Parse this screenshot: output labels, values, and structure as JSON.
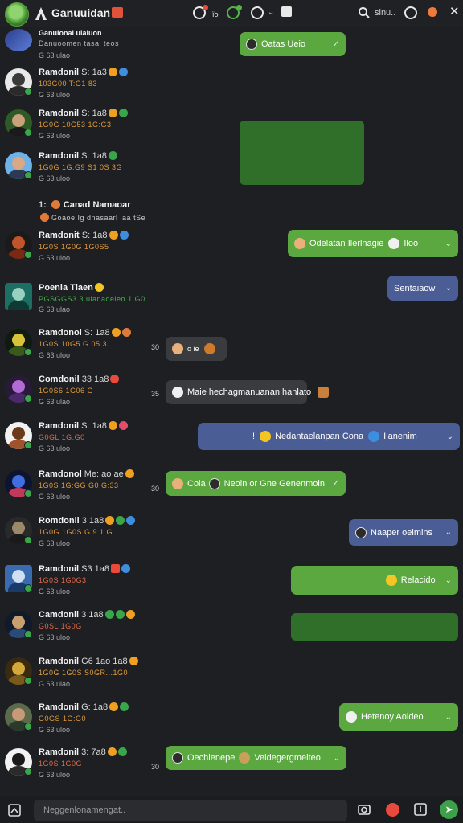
{
  "topbar": {
    "title": "Ganuuidan",
    "search_text": "sinu..",
    "colors": {
      "accent_green": "#5aa83f",
      "red": "#e84a3b"
    }
  },
  "rows": [
    {
      "name": "Ganulonal ulaluon",
      "time": "",
      "sub": "Danuoomen tasal teos",
      "meta": "G 63  ulao",
      "side": ""
    },
    {
      "name": "Ramdonil",
      "time": "S: 1a3",
      "sub": "103G00  T:G1 83",
      "meta": "G 63  uloo",
      "side": ""
    },
    {
      "name": "Ramdonil",
      "time": "S: 1a8",
      "sub": "1G0G  10G53  1G:G3",
      "meta": "G 63  uloo",
      "side": ""
    },
    {
      "name": "Ramdonil",
      "time": "S: 1a8",
      "sub": "1G0G  1G:G9  S1 0S 3G",
      "meta": "G 63  uloo",
      "side": ""
    },
    {
      "name": "Canad Namaoar",
      "time": "",
      "sub": "Goaoe  Ig dnasaarl laa tSe",
      "meta": "",
      "side": ""
    },
    {
      "name": "Ramdonit",
      "time": "S: 1a8",
      "sub": "1G0S  1G0G  1G0S5",
      "meta": "G 63  uloo",
      "side": ""
    },
    {
      "name": "Poenia  Tlaen",
      "time": "",
      "sub": "PGSGGS3  3  ulanaoeleo  1 G0",
      "meta": "G 63  ulao",
      "side": ""
    },
    {
      "name": "Ramdonol",
      "time": "S: 1a8",
      "sub": "1G0S  10G5  G 05 3",
      "meta": "G 63  uloo",
      "side": "30"
    },
    {
      "name": "Comdonil",
      "time": "33 1a8",
      "sub": "1G0S6  1G06  G",
      "meta": "G 63  ulao",
      "side": "35"
    },
    {
      "name": "Ramdonil",
      "time": "S: 1a8",
      "sub": "G0GL  1G:G0",
      "meta": "G 63  uloo",
      "side": ""
    },
    {
      "name": "Ramdonol",
      "time": "Me: ao ae",
      "sub": "1G0S  1G:GG  G0 G:33",
      "meta": "G 63  uloo",
      "side": "30"
    },
    {
      "name": "Romdonil",
      "time": "3 1a8",
      "sub": "1G0G  1G0S  G 9 1 G",
      "meta": "G 63  uloo",
      "side": ""
    },
    {
      "name": "Ramdonil",
      "time": "S3 1a8",
      "sub": "1G0S  1G0G3",
      "meta": "G 63  uloo",
      "side": ""
    },
    {
      "name": "Camdonil",
      "time": "3 1a8",
      "sub": "G0SL  1G0G",
      "meta": "G 63  uloo",
      "side": ""
    },
    {
      "name": "Ramdonil",
      "time": "G6  1ao  1a8",
      "sub": "1G0G  1G0S  S0GR...1G0",
      "meta": "G 63  ulao",
      "side": ""
    },
    {
      "name": "Ramdonil",
      "time": "G: 1a8",
      "sub": "G0GS  1G:G0",
      "meta": "G 63  uloo",
      "side": ""
    },
    {
      "name": "Ramdonil",
      "time": "3: 7a8",
      "sub": "1G0S  1G0G",
      "meta": "G 63  uloo",
      "side": "30"
    }
  ],
  "bubbles": {
    "b1": "Oatas  Ueio",
    "b2": "Odelatan  Ilerlnagie",
    "b2b": "Iloo",
    "b3": "Sentaiaow",
    "b4": "o  ie",
    "b5": "Maie  hechagmanuanan  hanlato",
    "b6": "Nedantaelanpan  Cona",
    "b6b": "Ilanenim",
    "b7": "Cola",
    "b7b": "Neoin  or  Gne  Genenmoin",
    "b8": "Naaper  oelmins",
    "b9": "Relacido",
    "b10": "Hetenoy  Aoldeo",
    "b11": "Oechlenepe",
    "b11b": "Veldegergmeiteo"
  },
  "bottombar": {
    "placeholder": "Neggenlonamengat..",
    "send_icon": "send-icon"
  }
}
